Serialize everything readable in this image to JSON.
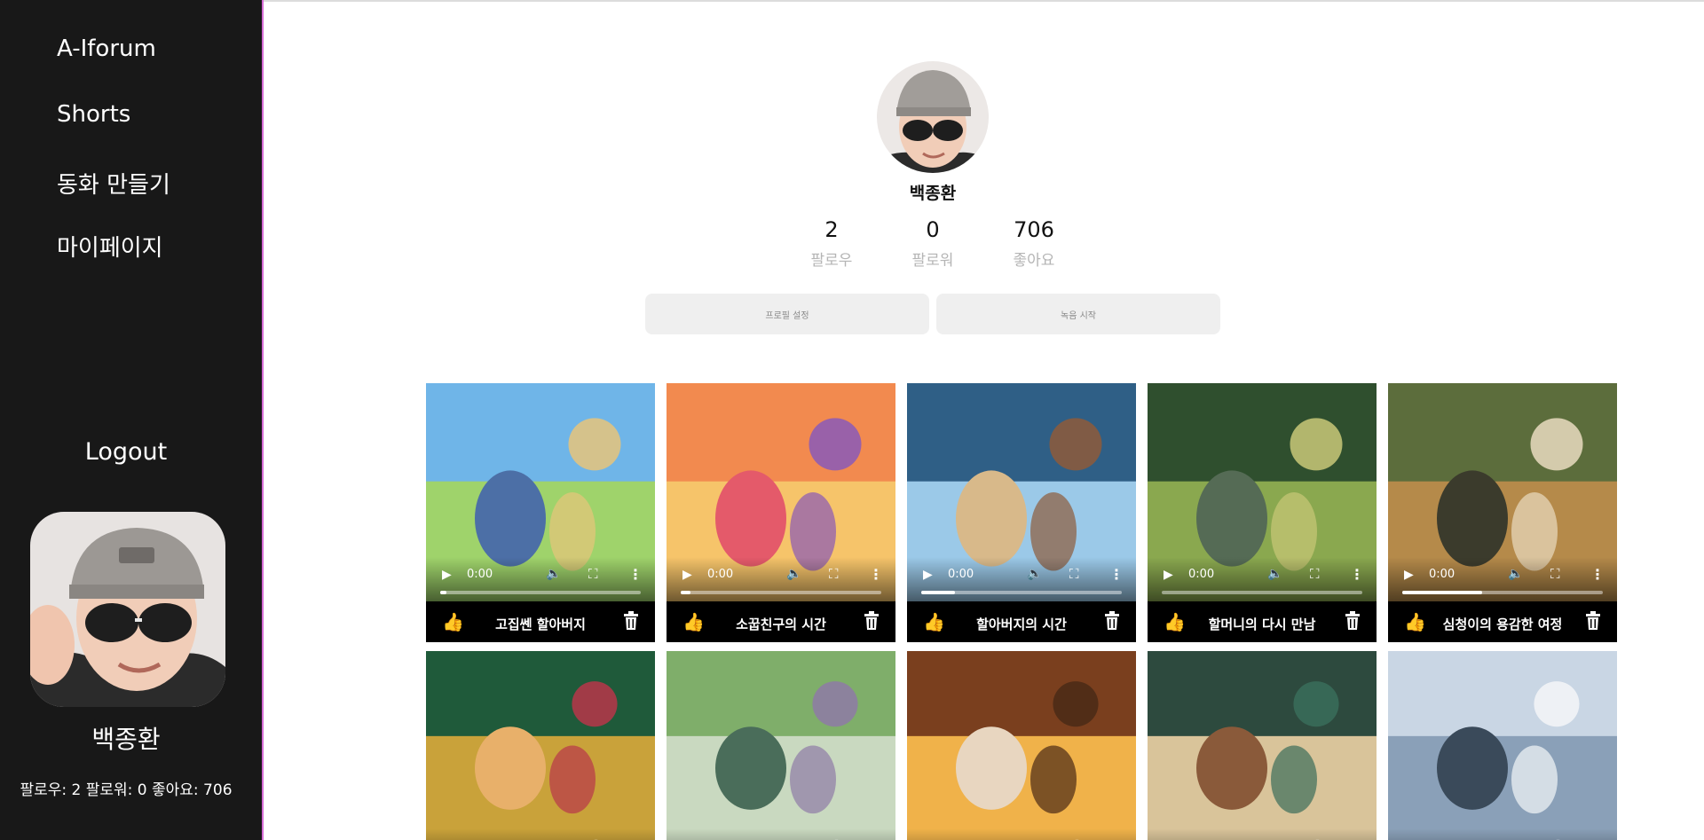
{
  "sidebar": {
    "nav": [
      "A-Iforum",
      "Shorts",
      "동화 만들기",
      "마이페이지"
    ],
    "logout": "Logout",
    "user_name": "백종환",
    "stats_line": "팔로우: 2 팔로워: 0 좋아요: 706"
  },
  "profile": {
    "name": "백종환",
    "stats": [
      {
        "value": "2",
        "label": "팔로우"
      },
      {
        "value": "0",
        "label": "팔로워"
      },
      {
        "value": "706",
        "label": "좋아요"
      }
    ],
    "buttons": {
      "settings": "프로필 설정",
      "record": "녹음 시작"
    }
  },
  "video_time": "0:00",
  "videos": [
    {
      "title": "고집쎈 할아버지",
      "progress": 0.03
    },
    {
      "title": "소꿉친구의 시간",
      "progress": 0.05
    },
    {
      "title": "할아버지의 시간",
      "progress": 0.17
    },
    {
      "title": "할머니의 다시 만남",
      "progress": 0.0
    },
    {
      "title": "심청이의 용감한 여정",
      "progress": 0.4
    }
  ],
  "videos_row2": [
    {
      "progress": 0.0
    },
    {
      "progress": 0.0
    },
    {
      "progress": 0.0
    },
    {
      "progress": 0.0
    },
    {
      "progress": 0.0
    }
  ],
  "icons": {
    "play": "play-icon",
    "volume": "volume-icon",
    "fullscreen": "fullscreen-icon",
    "more": "more-vertical-icon",
    "like": "thumbs-up-icon",
    "delete": "trash-icon"
  },
  "colors": {
    "sidebar_bg": "#181818",
    "sidebar_border": "#d46bd4",
    "button_bg": "#efefef"
  }
}
